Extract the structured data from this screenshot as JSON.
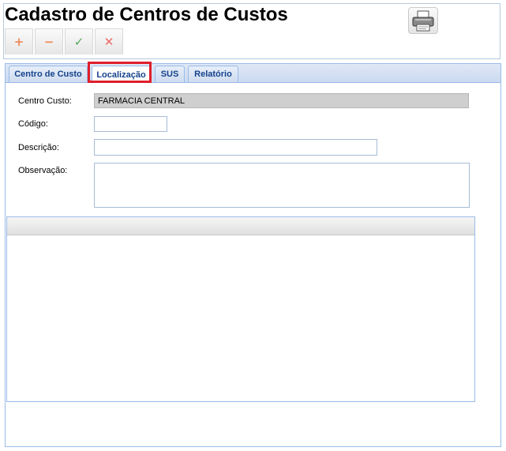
{
  "header": {
    "title": "Cadastro de Centros de Custos"
  },
  "toolbar": {
    "add_glyph": "+",
    "remove_glyph": "−",
    "confirm_glyph": "✓",
    "cancel_glyph": "✕"
  },
  "tabs": [
    {
      "label": "Centro de Custo",
      "active": false
    },
    {
      "label": "Localização",
      "active": true
    },
    {
      "label": "SUS",
      "active": false
    },
    {
      "label": "Relatório",
      "active": false
    }
  ],
  "form": {
    "centro_custo": {
      "label": "Centro Custo:",
      "value": "FARMACIA CENTRAL"
    },
    "codigo": {
      "label": "Código:",
      "value": ""
    },
    "descricao": {
      "label": "Descrição:",
      "value": ""
    },
    "observacao": {
      "label": "Observação:",
      "value": ""
    }
  },
  "colors": {
    "tab_text": "#15428b",
    "highlight": "#e01e2b",
    "panel_border": "#99bbe8"
  },
  "icons": [
    "add-icon",
    "remove-icon",
    "check-icon",
    "cancel-icon",
    "printer-icon"
  ]
}
